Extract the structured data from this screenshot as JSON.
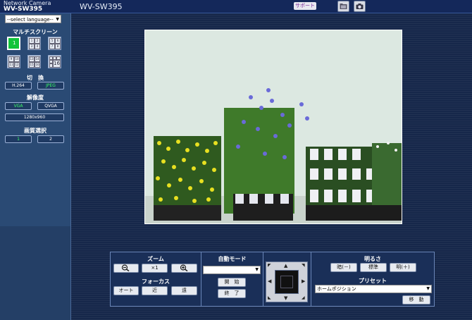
{
  "header": {
    "brand_line1": "Network Camera",
    "brand_line2": "WV-SW395",
    "camera_title": "WV-SW395",
    "support_label": "サポート",
    "icons": [
      "folder-icon",
      "camera-icon"
    ]
  },
  "sidebar": {
    "language_select": "--select language--",
    "multiscreen_label": "マルチスクリーン",
    "multiscreen_buttons": [
      {
        "name": "single",
        "cells": [
          "1"
        ]
      },
      {
        "name": "quad-1-4",
        "cells": [
          "1",
          "2",
          "3",
          "4"
        ]
      },
      {
        "name": "quad-5-8",
        "cells": [
          "5",
          "6",
          "7",
          "8"
        ]
      },
      {
        "name": "quad-9-12",
        "cells": [
          "9",
          "10",
          "11",
          "12"
        ]
      },
      {
        "name": "quad-13-16",
        "cells": [
          "13",
          "14",
          "15",
          "16"
        ]
      },
      {
        "name": "sixteen",
        "cells": [
          "16"
        ]
      }
    ],
    "switch_label": "切　換",
    "switch_buttons": [
      "H.264",
      "JPEG"
    ],
    "resolution_label": "解像度",
    "resolution_buttons": [
      "VGA",
      "QVGA",
      "1280x960"
    ],
    "quality_label": "画質選択",
    "quality_buttons": [
      "1",
      "2"
    ]
  },
  "controls": {
    "zoom_label": "ズーム",
    "zoom_x1": "×1",
    "focus_label": "フォーカス",
    "focus_buttons": [
      "オート",
      "近",
      "遠"
    ],
    "auto_mode_label": "自動モード",
    "auto_mode_select": "",
    "start_button": "開　始",
    "stop_button": "終　了",
    "brightness_label": "明るさ",
    "brightness_buttons": [
      "暗(－)",
      "標準",
      "明(＋)"
    ],
    "preset_label": "プリセット",
    "preset_select": "ホームポジション",
    "move_button": "移　動"
  },
  "colors": {
    "background": "#16274a",
    "sidebar": "#2a4a74",
    "active_green": "#12c43a",
    "green_text": "#3cff66"
  }
}
